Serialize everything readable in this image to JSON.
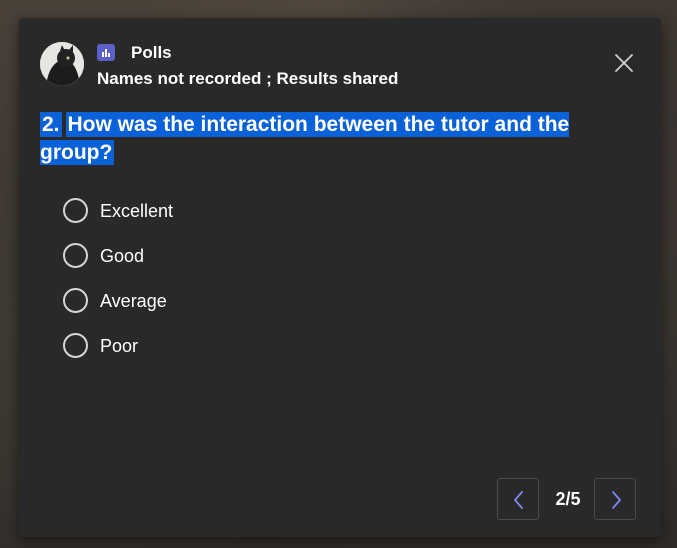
{
  "header": {
    "app_name": "Polls",
    "subtitle": "Names not recorded ; Results shared",
    "app_icon": "poll-bar-chart-icon",
    "close_icon": "close-icon"
  },
  "question": {
    "number": "2.",
    "text": "How was the interaction between the tutor and the group?"
  },
  "options": [
    {
      "label": "Excellent",
      "selected": false
    },
    {
      "label": "Good",
      "selected": false
    },
    {
      "label": "Average",
      "selected": false
    },
    {
      "label": "Poor",
      "selected": false
    }
  ],
  "pager": {
    "indicator": "2/5",
    "prev_icon": "chevron-left-icon",
    "next_icon": "chevron-right-icon"
  },
  "colors": {
    "card_bg": "#292929",
    "highlight": "#0a61d8",
    "accent": "#5b5fc7",
    "nav_chevron": "#7f85f5"
  }
}
